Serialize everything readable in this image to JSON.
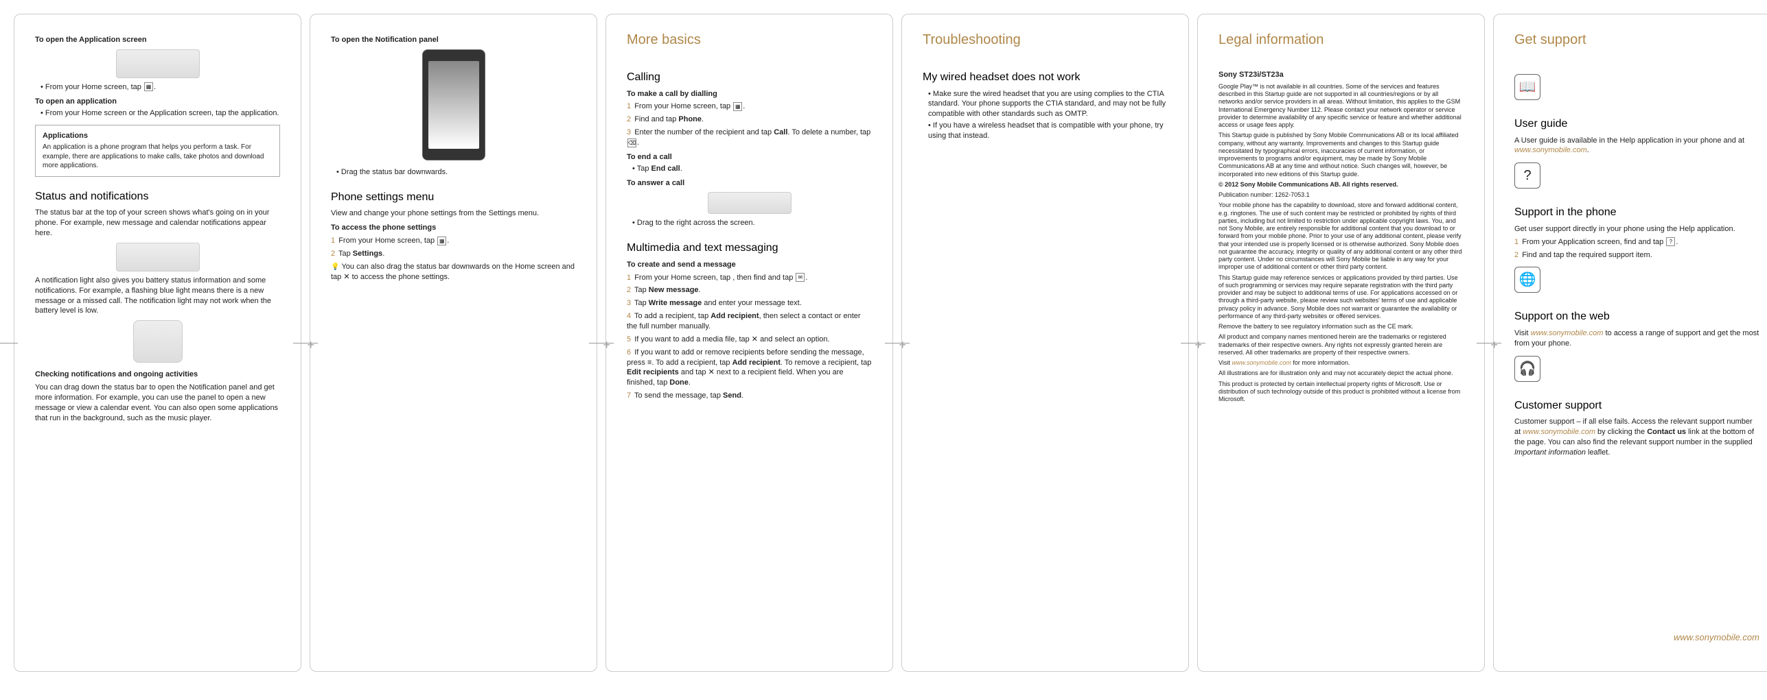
{
  "panel1": {
    "h_open_app_screen": "To open the Application screen",
    "bullet_from_home": "From your Home screen, tap",
    "h_open_app": "To open an application",
    "bullet_open_app": "From your Home screen or the Application screen, tap the application.",
    "box_h": "Applications",
    "box_body": "An application is a phone program that helps you perform a task. For example, there are applications to make calls, take photos and download more applications.",
    "h_status": "Status and notifications",
    "p_status": "The status bar at the top of your screen shows what's going on in your phone. For example, new message and calendar notifications appear here.",
    "p_notif_light": "A notification light also gives you battery status information and some notifications. For example, a flashing blue light means there is a new message or a missed call. The notification light may not work when the battery level is low.",
    "h_checking": "Checking notifications and ongoing activities",
    "p_checking": "You can drag down the status bar to open the Notification panel and get more information. For example, you can use the panel to open a new message or view a calendar event. You can also open some applications that run in the background, such as the music player."
  },
  "panel2": {
    "h_open_notif": "To open the Notification panel",
    "bullet_drag": "Drag the status bar downwards.",
    "h_settings": "Phone settings menu",
    "p_settings": "View and change your phone settings from the Settings menu.",
    "h_access": "To access the phone settings",
    "step1": "From your Home screen, tap",
    "step2_a": "Tap ",
    "step2_b": "Settings",
    "tip": "You can also drag the status bar downwards on the Home screen and tap ✕ to access the phone settings."
  },
  "panel3": {
    "title": "More basics",
    "h_calling": "Calling",
    "h_make_call": "To make a call by dialling",
    "c1": "From your Home screen, tap",
    "c2a": "Find and tap ",
    "c2b": "Phone",
    "c3a": "Enter the number of the recipient and tap ",
    "c3b": "Call",
    "c3c": ". To delete a number, tap",
    "h_end": "To end a call",
    "end_a": "Tap ",
    "end_b": "End call",
    "h_answer": "To answer a call",
    "drag_right": "Drag      to the right across the screen.",
    "h_mms": "Multimedia and text messaging",
    "h_create": "To create and send a message",
    "m1": "From your Home screen, tap      , then find and tap",
    "m2a": "Tap ",
    "m2b": "New message",
    "m3a": "Tap ",
    "m3b": "Write message",
    "m3c": " and enter your message text.",
    "m4a": "To add a recipient, tap ",
    "m4b": "Add recipient",
    "m4c": ", then select a contact or enter the full number manually.",
    "m5": "If you want to add a media file, tap ✕ and select an option.",
    "m6a": "If you want to add or remove recipients before sending the message, press ≡. To add a recipient, tap ",
    "m6b": "Add recipient",
    "m6c": ". To remove a recipient, tap ",
    "m6d": "Edit recipients",
    "m6e": " and tap ✕ next to a recipient field. When you are finished, tap ",
    "m6f": "Done",
    "m7a": "To send the message, tap ",
    "m7b": "Send"
  },
  "panel4": {
    "title": "Troubleshooting",
    "h_headset": "My wired headset does not work",
    "b1": "Make sure the wired headset that you are using complies to the CTIA standard. Your phone supports the CTIA standard, and may not be fully compatible with other standards such as OMTP.",
    "b2": "If you have a wireless headset that is compatible with your phone, try using that instead."
  },
  "panel5": {
    "title": "Legal information",
    "model": "Sony ST23i/ST23a",
    "p1": "Google Play™ is not available in all countries. Some of the services and features described in this Startup guide are not supported in all countries/regions or by all networks and/or service providers in all areas. Without limitation, this applies to the GSM International Emergency Number 112. Please contact your network operator or service provider to determine availability of any specific service or feature and whether additional access or usage fees apply.",
    "p2": "This Startup guide is published by Sony Mobile Communications AB or its local affiliated company, without any warranty. Improvements and changes to this Startup guide necessitated by typographical errors, inaccuracies of current information, or improvements to programs and/or equipment, may be made by Sony Mobile Communications AB at any time and without notice. Such changes will, however, be incorporated into new editions of this Startup guide.",
    "p3": "© 2012 Sony Mobile Communications AB. All rights reserved.",
    "p4": "Publication number: 1262-7053.1",
    "p5": "Your mobile phone has the capability to download, store and forward additional content, e.g. ringtones. The use of such content may be restricted or prohibited by rights of third parties, including but not limited to restriction under applicable copyright laws. You, and not Sony Mobile, are entirely responsible for additional content that you download to or forward from your mobile phone. Prior to your use of any additional content, please verify that your intended use is properly licensed or is otherwise authorized. Sony Mobile does not guarantee the accuracy, integrity or quality of any additional content or any other third party content. Under no circumstances will Sony Mobile be liable in any way for your improper use of additional content or other third party content.",
    "p6": "This Startup guide may reference services or applications provided by third parties. Use of such programming or services may require separate registration with the third party provider and may be subject to additional terms of use. For applications accessed on or through a third-party website, please review such websites' terms of use and applicable privacy policy in advance. Sony Mobile does not warrant or guarantee the availability or performance of any third-party websites or offered services.",
    "p7": "Remove the battery to see regulatory information such as the CE mark.",
    "p8": "All product and company names mentioned herein are the trademarks or registered trademarks of their respective owners. Any rights not expressly granted herein are reserved. All other trademarks are property of their respective owners.",
    "p9a": "Visit ",
    "p9link": "www.sonymobile.com",
    "p9b": " for more information.",
    "p10": "All illustrations are for illustration only and may not accurately depict the actual phone.",
    "p11": "This product is protected by certain intellectual property rights of Microsoft. Use or distribution of such technology outside of this product is prohibited without a license from Microsoft."
  },
  "panel6": {
    "title": "Get support",
    "h_guide": "User guide",
    "p_guide_a": "A User guide is available in the Help application in your phone and at ",
    "p_guide_link": "www.sonymobile.com",
    "h_phone": "Support in the phone",
    "p_phone": "Get user support directly in your phone using the Help application.",
    "s1": "From your Application screen, find and tap",
    "s2": "Find and tap the required support item.",
    "h_web": "Support on the web",
    "p_web_a": "Visit ",
    "p_web_link": "www.sonymobile.com",
    "p_web_b": " to access a range of support and get the most from your phone.",
    "h_cust": "Customer support",
    "p_cust_a": "Customer support – if all else fails. Access the relevant support number at ",
    "p_cust_link": "www.sonymobile.com",
    "p_cust_b": " by clicking the ",
    "p_cust_bold": "Contact us",
    "p_cust_c": " link at the bottom of the page. You can also find the relevant support number in the supplied ",
    "p_cust_i": "Important information",
    "p_cust_d": " leaflet.",
    "footer": "www.sonymobile.com"
  }
}
